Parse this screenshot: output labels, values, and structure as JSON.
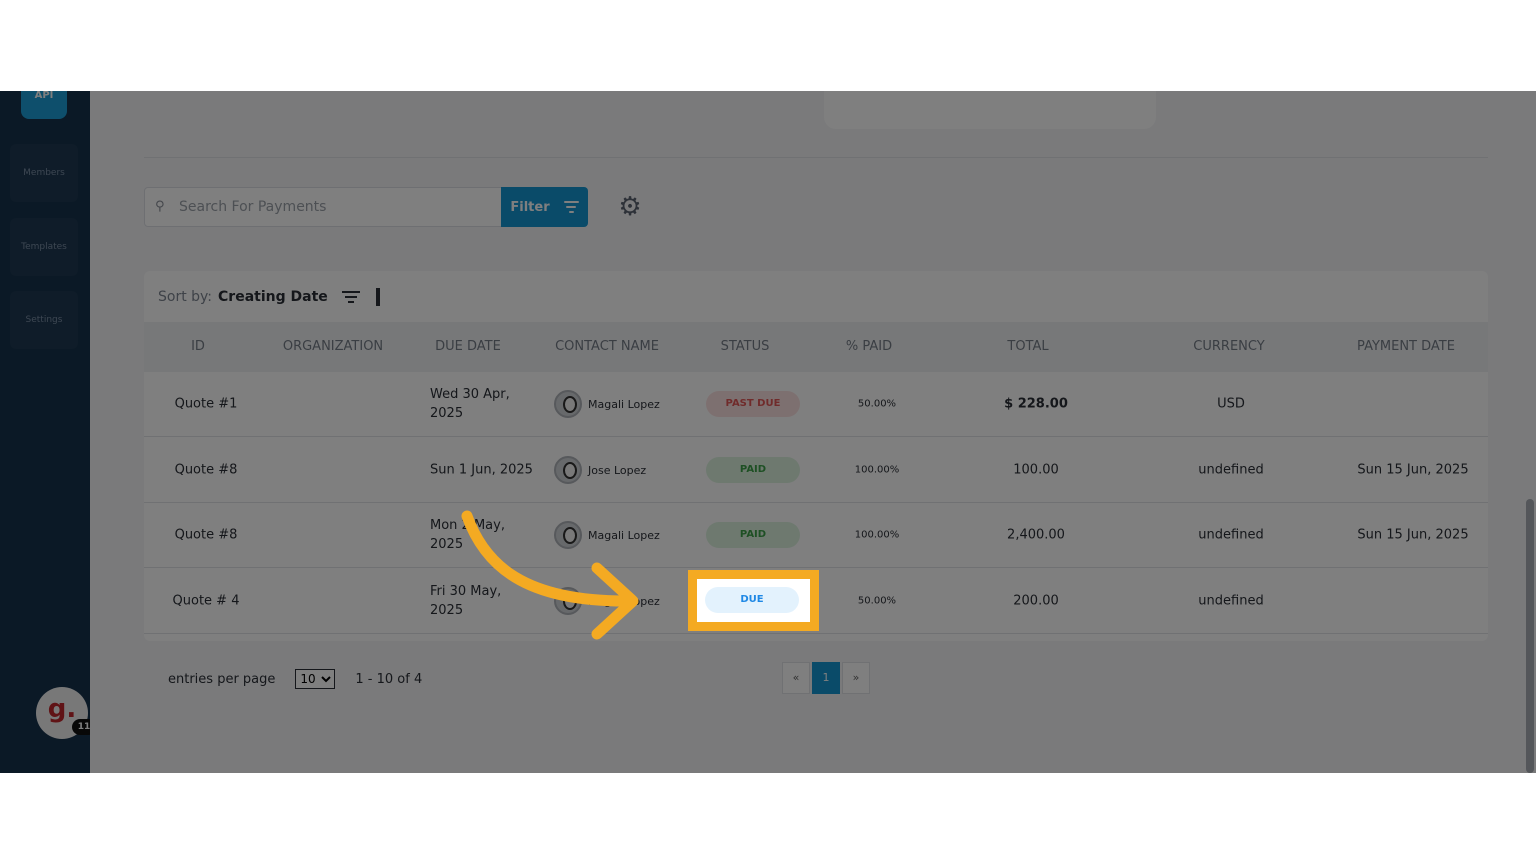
{
  "sidebar": {
    "logo": "API",
    "items": [
      {
        "label": "Members"
      },
      {
        "label": "Templates"
      },
      {
        "label": "Settings"
      }
    ],
    "avatar_letter": "g.",
    "notification_count": "11"
  },
  "toolbar": {
    "search_placeholder": "Search For Payments",
    "filter_label": "Filter"
  },
  "sort": {
    "label": "Sort by:",
    "value": "Creating Date"
  },
  "table": {
    "columns": [
      "ID",
      "ORGANIZATION",
      "DUE DATE",
      "CONTACT NAME",
      "STATUS",
      "% PAID",
      "TOTAL",
      "CURRENCY",
      "PAYMENT DATE"
    ],
    "rows": [
      {
        "id": "Quote #1",
        "organization": "",
        "due_date": "Wed 30 Apr, 2025",
        "contact": "Magali Lopez",
        "status": "PAST DUE",
        "paid": "50.00%",
        "total": "$ 228.00",
        "currency": "USD",
        "payment_date": ""
      },
      {
        "id": "Quote #8",
        "organization": "",
        "due_date": "Sun 1 Jun, 2025",
        "contact": "Jose Lopez",
        "status": "PAID",
        "paid": "100.00%",
        "total": "100.00",
        "currency": "undefined",
        "payment_date": "Sun 15 Jun, 2025"
      },
      {
        "id": "Quote #8",
        "organization": "",
        "due_date": "Mon 2 May, 2025",
        "contact": "Magali Lopez",
        "status": "PAID",
        "paid": "100.00%",
        "total": "2,400.00",
        "currency": "undefined",
        "payment_date": "Sun 15 Jun, 2025"
      },
      {
        "id": "Quote # 4",
        "organization": "",
        "due_date": "Fri 30 May, 2025",
        "contact": "Magali Lopez",
        "status": "DUE",
        "paid": "50.00%",
        "total": "200.00",
        "currency": "undefined",
        "payment_date": ""
      }
    ]
  },
  "pagination": {
    "entries_label": "entries per page",
    "per_page": "10",
    "range": "1 - 10 of 4",
    "prev": "«",
    "current": "1",
    "next": "»"
  },
  "colors": {
    "accent": "#1596d3",
    "highlight": "#f4aa22",
    "sidebar": "#17324d"
  }
}
